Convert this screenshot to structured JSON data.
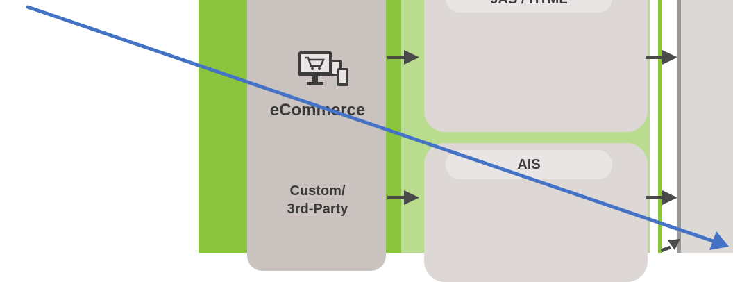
{
  "diagram": {
    "top_box_label": "JAS / HTML",
    "bottom_box_label": "AIS",
    "left_items": [
      {
        "icon": "ecommerce-devices-icon",
        "label": "eCommerce"
      },
      {
        "label_line1": "Custom/",
        "label_line2": "3rd-Party"
      }
    ]
  },
  "colors": {
    "green": "#8bc53f",
    "light_green": "#b9dc8e",
    "gray_box": "#ddd8d6",
    "column_gray": "#c9c2bf",
    "arrow": "#4a4a4a",
    "annotation_line": "#4472c4"
  }
}
